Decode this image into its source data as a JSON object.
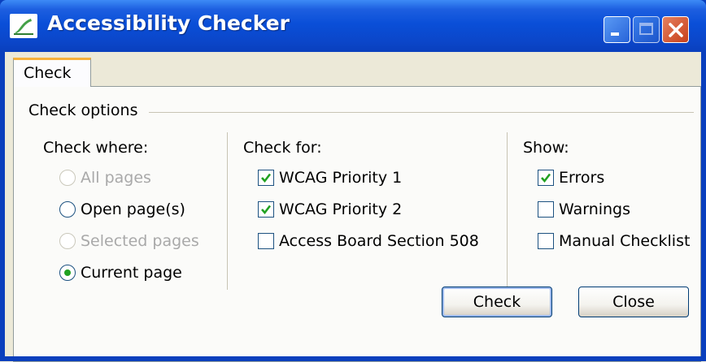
{
  "window": {
    "title": "Accessibility Checker"
  },
  "tabs": [
    {
      "label": "Check",
      "active": true
    }
  ],
  "check_options": {
    "group_label": "Check options",
    "check_where": {
      "heading": "Check where:",
      "options": [
        {
          "label": "All pages",
          "selected": false,
          "enabled": false
        },
        {
          "label": "Open page(s)",
          "selected": false,
          "enabled": true
        },
        {
          "label": "Selected pages",
          "selected": false,
          "enabled": false
        },
        {
          "label": "Current page",
          "selected": true,
          "enabled": true
        }
      ]
    },
    "check_for": {
      "heading": "Check for:",
      "options": [
        {
          "label": "WCAG Priority 1",
          "checked": true
        },
        {
          "label": "WCAG Priority 2",
          "checked": true
        },
        {
          "label": "Access Board Section 508",
          "checked": false
        }
      ]
    },
    "show": {
      "heading": "Show:",
      "options": [
        {
          "label": "Errors",
          "checked": true
        },
        {
          "label": "Warnings",
          "checked": false
        },
        {
          "label": "Manual Checklist",
          "checked": false
        }
      ]
    }
  },
  "buttons": {
    "check_label": "Check",
    "close_label": "Close"
  },
  "colors": {
    "titlebar": "#0a4fd8",
    "check_mark": "#21a121",
    "radio_dot": "#21a121",
    "tab_highlight": "#f7b13a",
    "close_button": "#c7401b"
  }
}
